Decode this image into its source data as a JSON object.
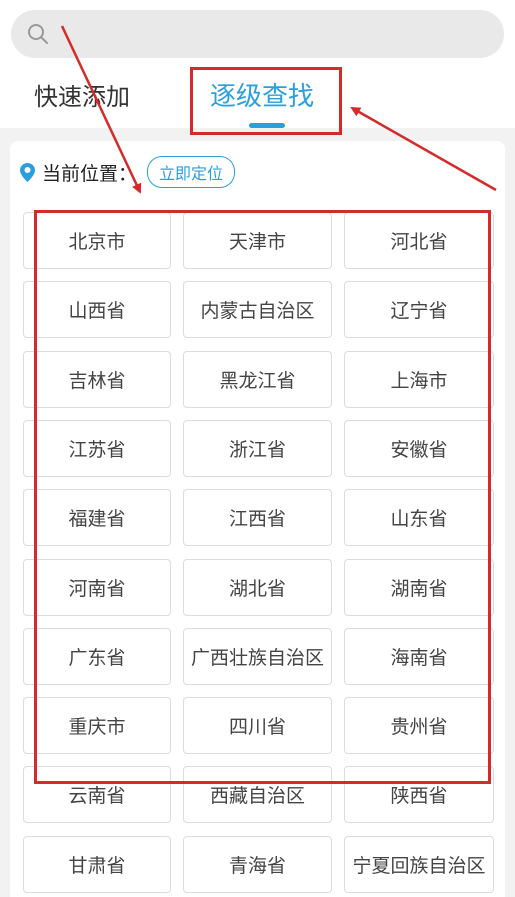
{
  "search": {
    "placeholder": ""
  },
  "tabs": [
    {
      "label": "快速添加",
      "active": false
    },
    {
      "label": "逐级查找",
      "active": true
    }
  ],
  "location": {
    "label": "当前位置：",
    "button": "立即定位"
  },
  "provinces": [
    "北京市",
    "天津市",
    "河北省",
    "山西省",
    "内蒙古自治区",
    "辽宁省",
    "吉林省",
    "黑龙江省",
    "上海市",
    "江苏省",
    "浙江省",
    "安徽省",
    "福建省",
    "江西省",
    "山东省",
    "河南省",
    "湖北省",
    "湖南省",
    "广东省",
    "广西壮族自治区",
    "海南省",
    "重庆市",
    "四川省",
    "贵州省",
    "云南省",
    "西藏自治区",
    "陕西省",
    "甘肃省",
    "青海省",
    "宁夏回族自治区"
  ],
  "colors": {
    "accent": "#2b9fdd",
    "annotation": "#d42a2a"
  },
  "icons": {
    "search": "search-icon",
    "location": "location-pin-icon"
  }
}
